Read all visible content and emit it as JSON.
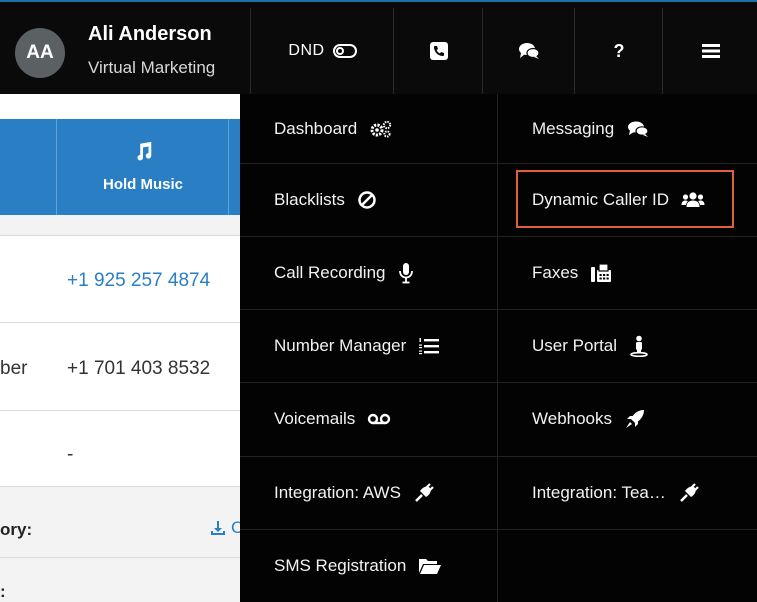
{
  "user": {
    "initials": "AA",
    "name": "Ali Anderson",
    "organization": "Virtual Marketing"
  },
  "topbar": {
    "dnd_label": "DND",
    "help_label": "?"
  },
  "table": {
    "header": {
      "first_col_fragment": ")",
      "hold_music_label": "Hold Music"
    },
    "rows": [
      {
        "left": "",
        "right": "+1 925 257 4874",
        "right_is_link": true
      },
      {
        "left": "ber",
        "right": "+1 701 403 8532"
      },
      {
        "left": "",
        "right": "-"
      }
    ],
    "section_labels": [
      "ory:",
      ":"
    ],
    "download_fragment": "C"
  },
  "menu": {
    "left_items": [
      {
        "label": "Dashboard",
        "icon": "cogs-icon"
      },
      {
        "label": "Blacklists",
        "icon": "ban-icon"
      },
      {
        "label": "Call Recording",
        "icon": "microphone-icon"
      },
      {
        "label": "Number Manager",
        "icon": "list-ol-icon"
      },
      {
        "label": "Voicemails",
        "icon": "voicemail-icon"
      },
      {
        "label": "Integration: AWS",
        "icon": "plug-icon"
      },
      {
        "label": "SMS Registration",
        "icon": "folder-open-icon"
      }
    ],
    "right_items": [
      {
        "label": "Messaging",
        "icon": "comments-icon"
      },
      {
        "label": "Dynamic Caller ID",
        "icon": "users-icon",
        "highlighted": true
      },
      {
        "label": "Faxes",
        "icon": "fax-icon"
      },
      {
        "label": "User Portal",
        "icon": "user-portal-icon"
      },
      {
        "label": "Webhooks",
        "icon": "rocket-icon"
      },
      {
        "label": "Integration: Tea…",
        "icon": "plug-icon"
      }
    ],
    "highlight_color": "#e0603d"
  },
  "colors": {
    "topbar_bg": "#0a0a0a",
    "menu_bg": "#030303",
    "table_header_bg": "#2a7ec3",
    "link": "#2a7ec3"
  }
}
